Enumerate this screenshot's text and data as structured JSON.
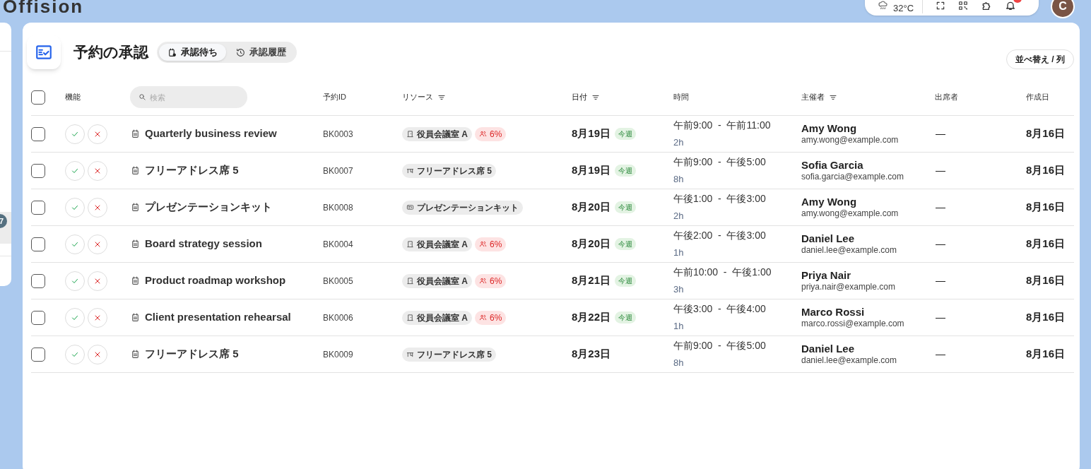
{
  "app": {
    "logo": "Offision",
    "weather": "32°C",
    "avatar": "C",
    "notifications": true
  },
  "sidebar": {
    "badge": "7"
  },
  "page": {
    "title": "予約の承認",
    "tabs": [
      {
        "label": "承認待ち",
        "kind": "pending",
        "selected": true
      },
      {
        "label": "承認履歴",
        "kind": "history",
        "selected": false
      }
    ],
    "sort_button": "並べ替え / 列"
  },
  "table": {
    "select_all": false,
    "columns": [
      {
        "label": "機能",
        "sortable": false
      },
      {
        "placeholder": "検索",
        "kind": "search"
      },
      {
        "label": "予約ID",
        "sortable": false
      },
      {
        "label": "リソース",
        "sortable": true
      },
      {
        "label": "日付",
        "sortable": true
      },
      {
        "label": "時間",
        "sortable": false
      },
      {
        "label": "主催者",
        "sortable": true
      },
      {
        "label": "出席者",
        "sortable": false
      },
      {
        "label": "作成日",
        "sortable": false
      }
    ],
    "rows": [
      {
        "checked": false,
        "title": "Quarterly business review",
        "id": "BK0003",
        "resource": {
          "kind": "room",
          "name": "役員会議室 A",
          "usage": "6%"
        },
        "date": "8月19日",
        "week_badge": "今週",
        "time": "午前9:00  -  午前11:00",
        "duration": "2h",
        "organizer": "Amy Wong",
        "email": "amy.wong@example.com",
        "attendees": "—",
        "created": "8月16日"
      },
      {
        "checked": false,
        "title": "フリーアドレス席 5",
        "id": "BK0007",
        "resource": {
          "kind": "desk",
          "name": "フリーアドレス席 5"
        },
        "date": "8月19日",
        "week_badge": "今週",
        "time": "午前9:00  -  午後5:00",
        "duration": "8h",
        "organizer": "Sofia Garcia",
        "email": "sofia.garcia@example.com",
        "attendees": "—",
        "created": "8月16日"
      },
      {
        "checked": false,
        "title": "プレゼンテーションキット",
        "id": "BK0008",
        "resource": {
          "kind": "kit",
          "name": "プレゼンテーションキット"
        },
        "date": "8月20日",
        "week_badge": "今週",
        "time": "午後1:00  -  午後3:00",
        "duration": "2h",
        "organizer": "Amy Wong",
        "email": "amy.wong@example.com",
        "attendees": "—",
        "created": "8月16日"
      },
      {
        "checked": false,
        "title": "Board strategy session",
        "id": "BK0004",
        "resource": {
          "kind": "room",
          "name": "役員会議室 A",
          "usage": "6%"
        },
        "date": "8月20日",
        "week_badge": "今週",
        "time": "午後2:00  -  午後3:00",
        "duration": "1h",
        "organizer": "Daniel Lee",
        "email": "daniel.lee@example.com",
        "attendees": "—",
        "created": "8月16日"
      },
      {
        "checked": false,
        "title": "Product roadmap workshop",
        "id": "BK0005",
        "resource": {
          "kind": "room",
          "name": "役員会議室 A",
          "usage": "6%"
        },
        "date": "8月21日",
        "week_badge": "今週",
        "time": "午前10:00  -  午後1:00",
        "duration": "3h",
        "organizer": "Priya Nair",
        "email": "priya.nair@example.com",
        "attendees": "—",
        "created": "8月16日"
      },
      {
        "checked": false,
        "title": "Client presentation rehearsal",
        "id": "BK0006",
        "resource": {
          "kind": "room",
          "name": "役員会議室 A",
          "usage": "6%"
        },
        "date": "8月22日",
        "week_badge": "今週",
        "time": "午後3:00  -  午後4:00",
        "duration": "1h",
        "organizer": "Marco Rossi",
        "email": "marco.rossi@example.com",
        "attendees": "—",
        "created": "8月16日"
      },
      {
        "checked": false,
        "title": "フリーアドレス席 5",
        "id": "BK0009",
        "resource": {
          "kind": "desk",
          "name": "フリーアドレス席 5"
        },
        "date": "8月23日",
        "time": "午前9:00  -  午後5:00",
        "duration": "8h",
        "organizer": "Daniel Lee",
        "email": "daniel.lee@example.com",
        "attendees": "—",
        "created": "8月16日"
      }
    ]
  }
}
